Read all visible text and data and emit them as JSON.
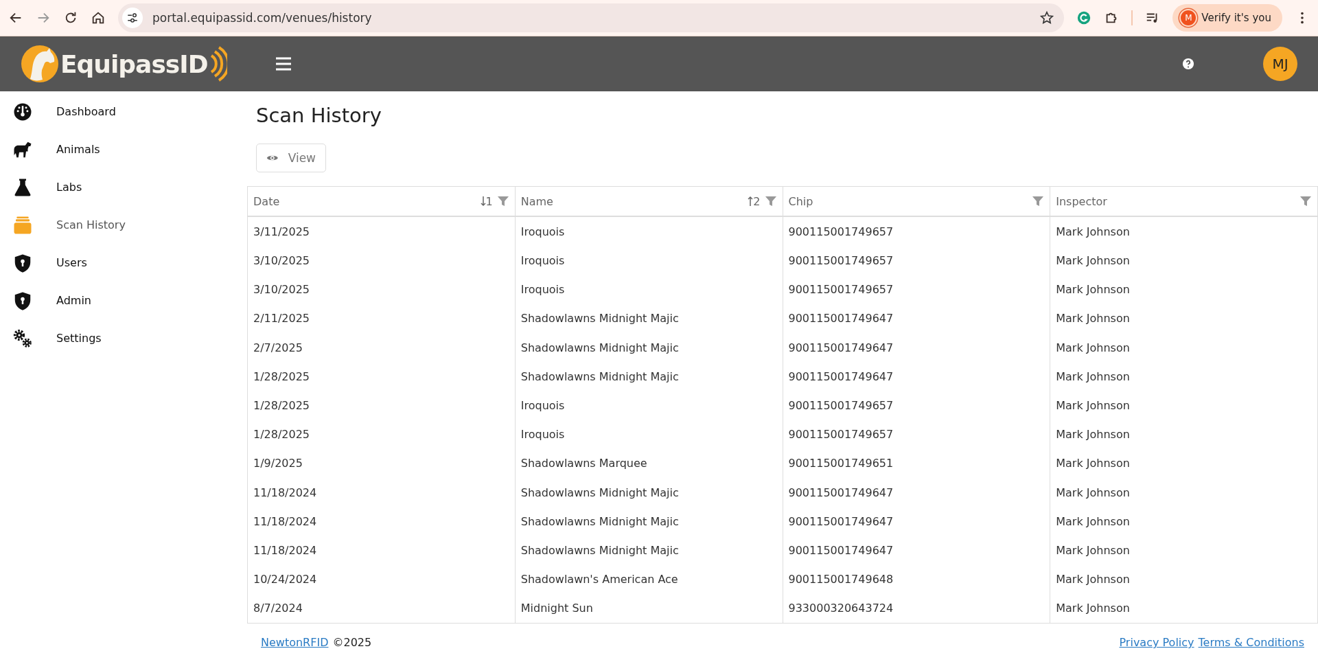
{
  "browser": {
    "url": "portal.equipassid.com/venues/history",
    "profile_initial": "M",
    "profile_label": "Verify it's you"
  },
  "header": {
    "logo_text": "EquipassID",
    "avatar_initials": "MJ"
  },
  "sidebar": {
    "items": [
      {
        "label": "Dashboard",
        "selected": false
      },
      {
        "label": "Animals",
        "selected": false
      },
      {
        "label": "Labs",
        "selected": false
      },
      {
        "label": "Scan History",
        "selected": true
      },
      {
        "label": "Users",
        "selected": false
      },
      {
        "label": "Admin",
        "selected": false
      },
      {
        "label": "Settings",
        "selected": false
      }
    ]
  },
  "page": {
    "title": "Scan History",
    "view_button": "View"
  },
  "table": {
    "columns": [
      {
        "label": "Date",
        "kind": "descending",
        "sort_order": "1"
      },
      {
        "label": "Name",
        "kind": "ascending",
        "sort_order": "2"
      },
      {
        "label": "Chip",
        "kind": "plain"
      },
      {
        "label": "Inspector",
        "kind": "plain"
      }
    ],
    "rows": [
      [
        "3/11/2025",
        "Iroquois",
        "900115001749657",
        "Mark Johnson"
      ],
      [
        "3/10/2025",
        "Iroquois",
        "900115001749657",
        "Mark Johnson"
      ],
      [
        "3/10/2025",
        "Iroquois",
        "900115001749657",
        "Mark Johnson"
      ],
      [
        "2/11/2025",
        "Shadowlawns Midnight Majic",
        "900115001749647",
        "Mark Johnson"
      ],
      [
        "2/7/2025",
        "Shadowlawns Midnight Majic",
        "900115001749647",
        "Mark Johnson"
      ],
      [
        "1/28/2025",
        "Shadowlawns Midnight Majic",
        "900115001749647",
        "Mark Johnson"
      ],
      [
        "1/28/2025",
        "Iroquois",
        "900115001749657",
        "Mark Johnson"
      ],
      [
        "1/28/2025",
        "Iroquois",
        "900115001749657",
        "Mark Johnson"
      ],
      [
        "1/9/2025",
        "Shadowlawns Marquee",
        "900115001749651",
        "Mark Johnson"
      ],
      [
        "11/18/2024",
        "Shadowlawns Midnight Majic",
        "900115001749647",
        "Mark Johnson"
      ],
      [
        "11/18/2024",
        "Shadowlawns Midnight Majic",
        "900115001749647",
        "Mark Johnson"
      ],
      [
        "11/18/2024",
        "Shadowlawns Midnight Majic",
        "900115001749647",
        "Mark Johnson"
      ],
      [
        "10/24/2024",
        "Shadowlawn's American Ace",
        "900115001749648",
        "Mark Johnson"
      ],
      [
        "8/7/2024",
        "Midnight Sun",
        "933000320643724",
        "Mark Johnson"
      ]
    ]
  },
  "footer": {
    "company_link": "NewtonRFID",
    "copyright": "©2025",
    "links": [
      "Privacy Policy",
      "Terms & Conditions"
    ]
  }
}
